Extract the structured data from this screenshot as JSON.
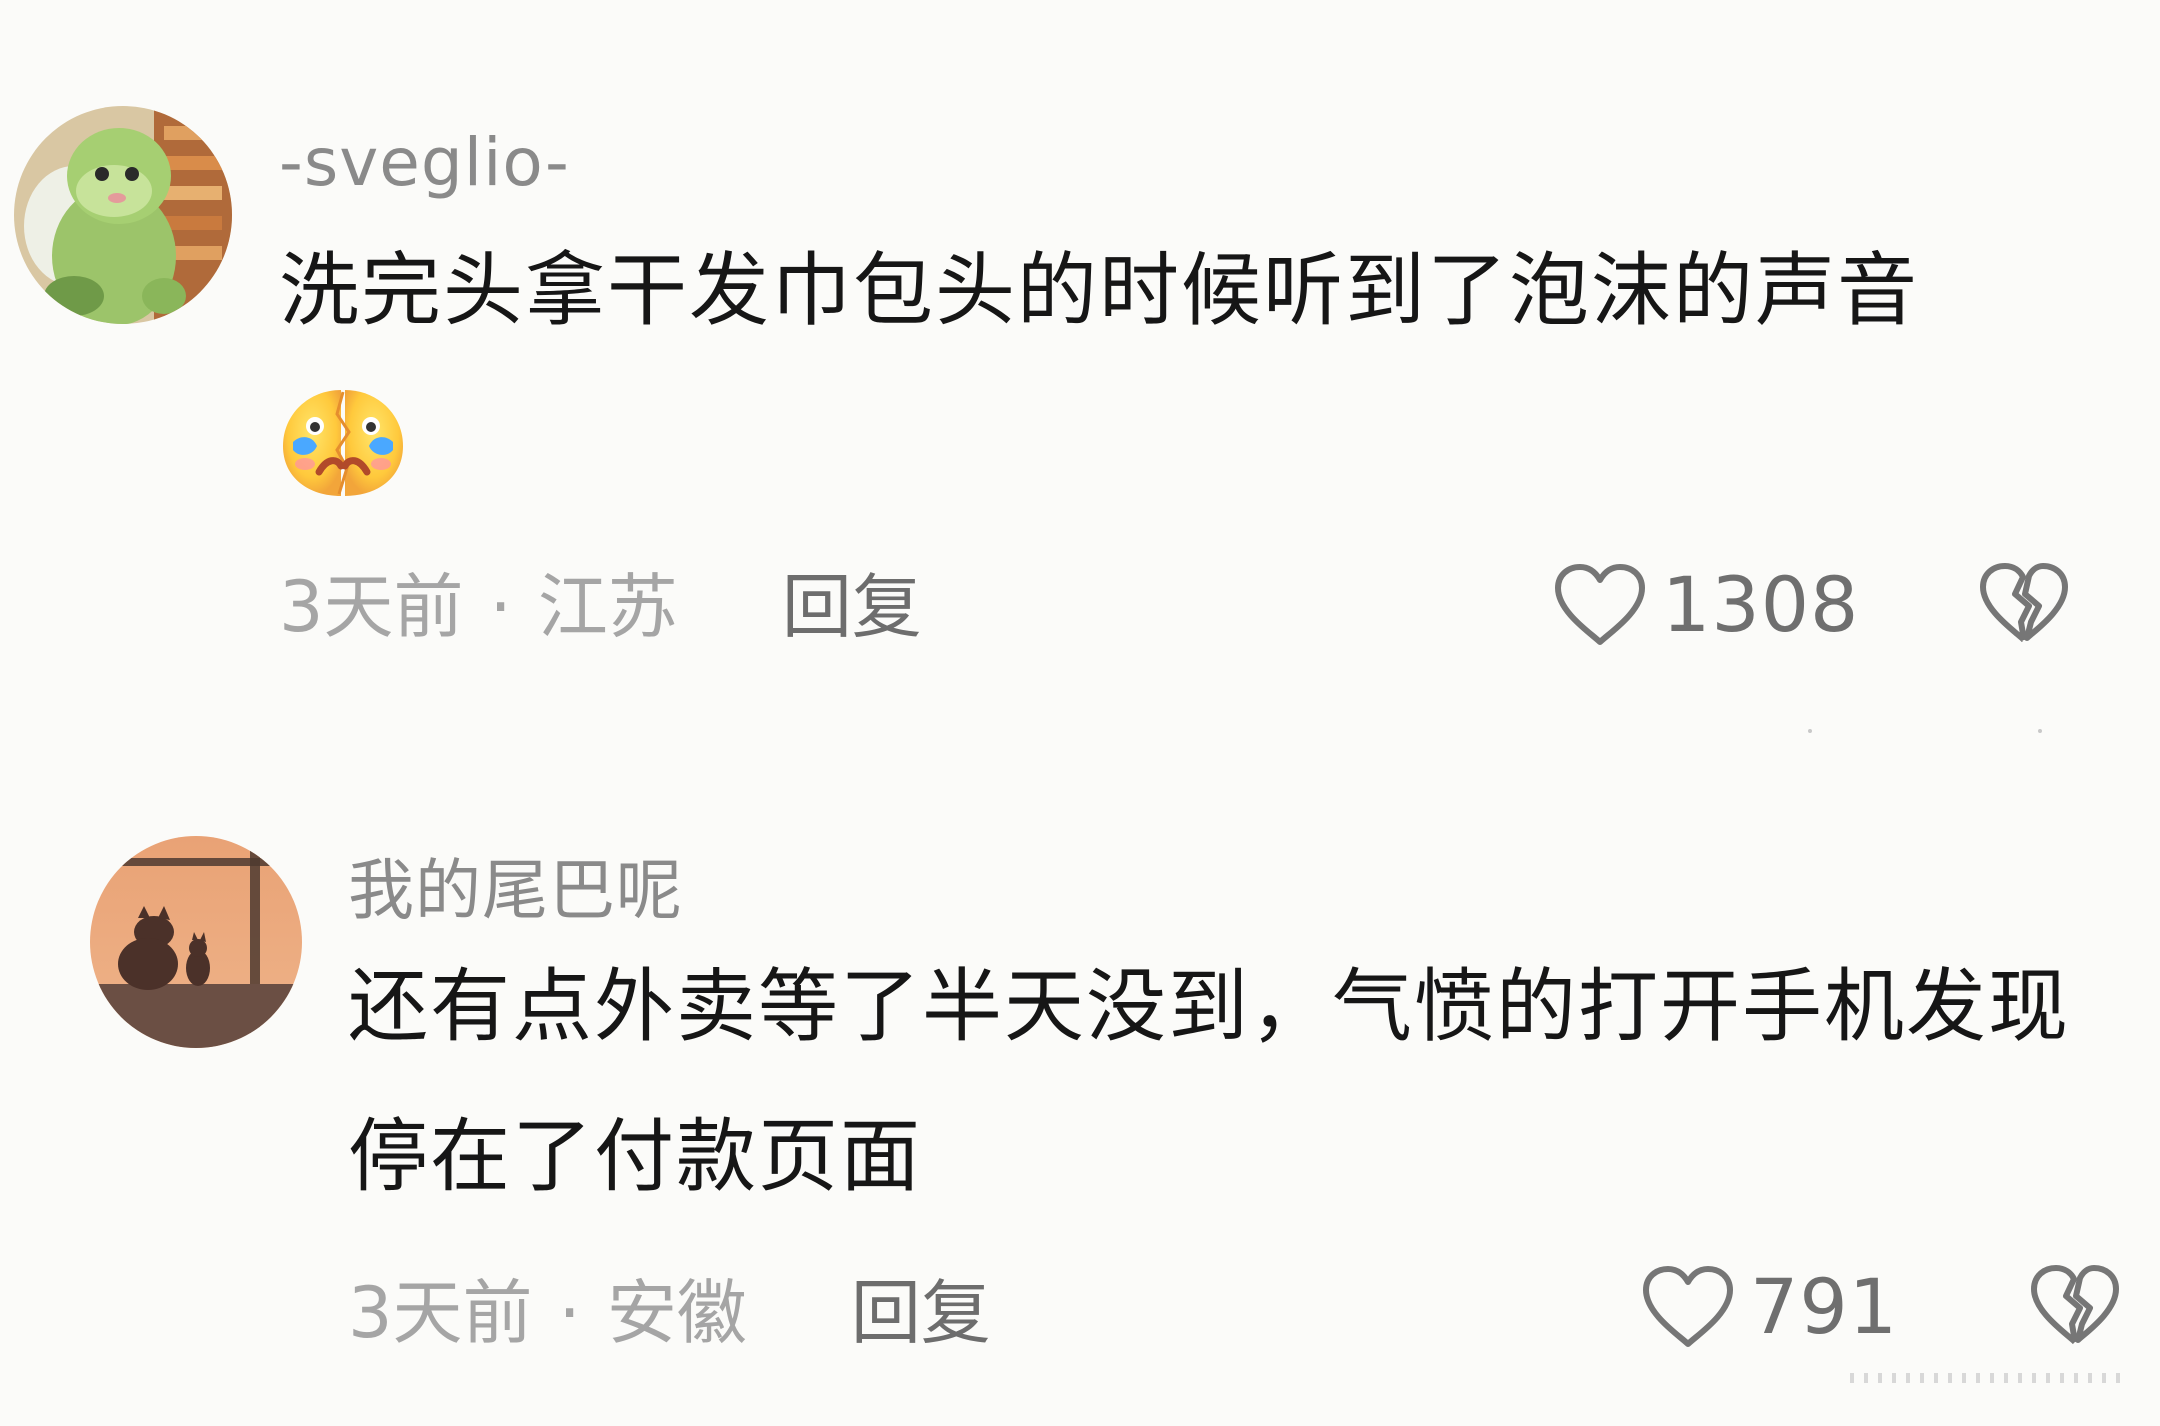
{
  "comments": [
    {
      "username": "-sveglio-",
      "avatar": "avatar-green-turtle-plush",
      "content": "洗完头拿干发巾包头的时候听到了泡沫的声音",
      "emoji": "crying-broken-heart-face-emoji",
      "time": "3天前",
      "separator": "·",
      "location": "江苏",
      "reply_label": "回复",
      "likes": "1308"
    },
    {
      "username": "我的尾巴呢",
      "avatar": "avatar-sunset-cat-silhouette",
      "content": "还有点外卖等了半天没到，气愤的打开手机发现停在了付款页面",
      "time": "3天前",
      "separator": "·",
      "location": "安徽",
      "reply_label": "回复",
      "likes": "791"
    }
  ],
  "colors": {
    "background": "#fbfbf9",
    "text_primary": "#161616",
    "text_secondary": "#8a8a8a",
    "text_meta": "#a5a5a5",
    "reply_text": "#6d6d6d",
    "icon_stroke": "#767676"
  },
  "icons": {
    "like": "heart-outline-icon",
    "dislike": "broken-heart-outline-icon"
  }
}
